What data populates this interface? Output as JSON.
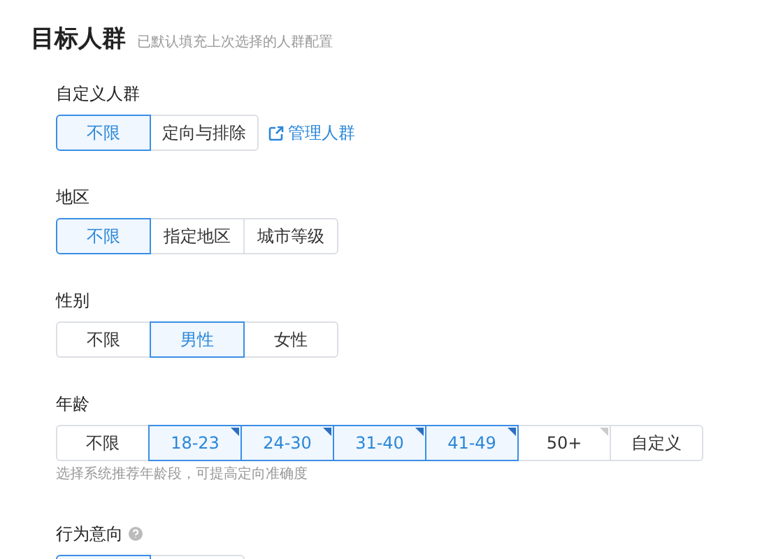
{
  "header": {
    "title": "目标人群",
    "subtitle": "已默认填充上次选择的人群配置"
  },
  "sections": [
    {
      "label": "自定义人群",
      "options": [
        {
          "label": "不限",
          "selected": true
        },
        {
          "label": "定向与排除",
          "selected": false
        }
      ],
      "link": "管理人群"
    },
    {
      "label": "地区",
      "options": [
        {
          "label": "不限",
          "selected": true
        },
        {
          "label": "指定地区",
          "selected": false
        },
        {
          "label": "城市等级",
          "selected": false
        }
      ]
    },
    {
      "label": "性别",
      "options": [
        {
          "label": "不限",
          "selected": false
        },
        {
          "label": "男性",
          "selected": true
        },
        {
          "label": "女性",
          "selected": false
        }
      ]
    },
    {
      "label": "年龄",
      "options": [
        {
          "label": "不限",
          "selected": false,
          "recommended": false
        },
        {
          "label": "18-23",
          "selected": true,
          "recommended": true
        },
        {
          "label": "24-30",
          "selected": true,
          "recommended": true
        },
        {
          "label": "31-40",
          "selected": true,
          "recommended": true
        },
        {
          "label": "41-49",
          "selected": true,
          "recommended": true
        },
        {
          "label": "50+",
          "selected": false,
          "recommended": true
        },
        {
          "label": "自定义",
          "selected": false,
          "recommended": false
        }
      ],
      "hint": "选择系统推荐年龄段，可提高定向准确度"
    },
    {
      "label": "行为意向",
      "help": true,
      "options": [
        {
          "selected": true
        },
        {
          "selected": false
        }
      ]
    }
  ]
}
